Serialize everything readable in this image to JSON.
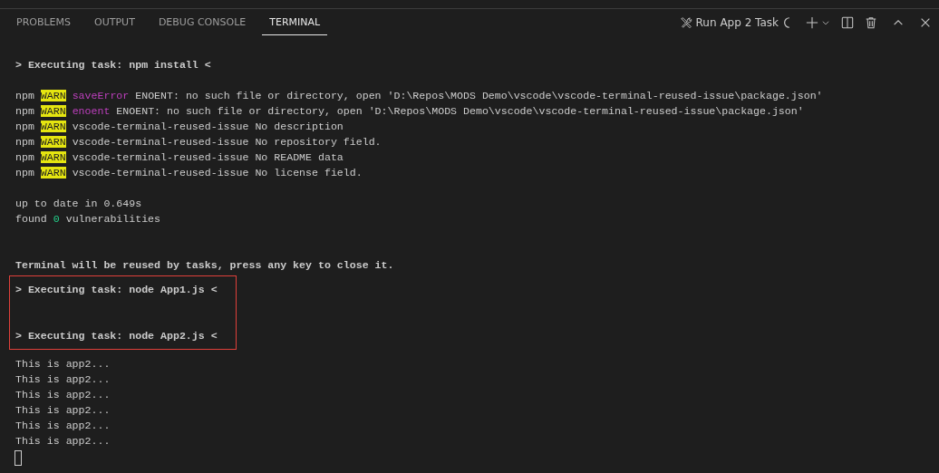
{
  "tabs": [
    {
      "label": "PROBLEMS",
      "selected": false
    },
    {
      "label": "OUTPUT",
      "selected": false
    },
    {
      "label": "DEBUG CONSOLE",
      "selected": false
    },
    {
      "label": "TERMINAL",
      "selected": true
    }
  ],
  "toolbar": {
    "task_label": "Run App 2 Task"
  },
  "terminal": {
    "blocks": [
      {
        "highlighted": false,
        "lines": [
          {
            "kind": "task",
            "segments": [
              {
                "kind": "plain",
                "text": "> Executing task: npm install <"
              }
            ]
          },
          {
            "kind": "blank"
          },
          {
            "kind": "output",
            "segments": [
              {
                "kind": "plain",
                "text": "npm "
              },
              {
                "kind": "warn",
                "text": "WARN"
              },
              {
                "kind": "magenta",
                "text": " saveError"
              },
              {
                "kind": "plain",
                "text": " ENOENT: no such file or directory, open 'D:\\Repos\\MODS Demo\\vscode\\vscode-terminal-reused-issue\\package.json'"
              }
            ]
          },
          {
            "kind": "output",
            "segments": [
              {
                "kind": "plain",
                "text": "npm "
              },
              {
                "kind": "warn",
                "text": "WARN"
              },
              {
                "kind": "magenta",
                "text": " enoent"
              },
              {
                "kind": "plain",
                "text": " ENOENT: no such file or directory, open 'D:\\Repos\\MODS Demo\\vscode\\vscode-terminal-reused-issue\\package.json'"
              }
            ]
          },
          {
            "kind": "output",
            "segments": [
              {
                "kind": "plain",
                "text": "npm "
              },
              {
                "kind": "warn",
                "text": "WARN"
              },
              {
                "kind": "plain",
                "text": " vscode-terminal-reused-issue No description"
              }
            ]
          },
          {
            "kind": "output",
            "segments": [
              {
                "kind": "plain",
                "text": "npm "
              },
              {
                "kind": "warn",
                "text": "WARN"
              },
              {
                "kind": "plain",
                "text": " vscode-terminal-reused-issue No repository field."
              }
            ]
          },
          {
            "kind": "output",
            "segments": [
              {
                "kind": "plain",
                "text": "npm "
              },
              {
                "kind": "warn",
                "text": "WARN"
              },
              {
                "kind": "plain",
                "text": " vscode-terminal-reused-issue No README data"
              }
            ]
          },
          {
            "kind": "output",
            "segments": [
              {
                "kind": "plain",
                "text": "npm "
              },
              {
                "kind": "warn",
                "text": "WARN"
              },
              {
                "kind": "plain",
                "text": " vscode-terminal-reused-issue No license field."
              }
            ]
          },
          {
            "kind": "blank"
          },
          {
            "kind": "output",
            "segments": [
              {
                "kind": "plain",
                "text": "up to date in 0.649s"
              }
            ]
          },
          {
            "kind": "output",
            "segments": [
              {
                "kind": "plain",
                "text": "found "
              },
              {
                "kind": "number",
                "text": "0"
              },
              {
                "kind": "plain",
                "text": " vulnerabilities"
              }
            ]
          },
          {
            "kind": "blank"
          },
          {
            "kind": "blank"
          },
          {
            "kind": "task",
            "segments": [
              {
                "kind": "plain",
                "text": "Terminal will be reused by tasks, press any key to close it."
              }
            ]
          }
        ]
      },
      {
        "highlighted": true,
        "lines": [
          {
            "kind": "task",
            "segments": [
              {
                "kind": "plain",
                "text": "> Executing task: node App1.js <"
              }
            ]
          },
          {
            "kind": "blank"
          },
          {
            "kind": "blank"
          },
          {
            "kind": "task",
            "segments": [
              {
                "kind": "plain",
                "text": "> Executing task: node App2.js <"
              }
            ]
          }
        ]
      },
      {
        "highlighted": false,
        "lines": [
          {
            "kind": "output",
            "segments": [
              {
                "kind": "plain",
                "text": "This is app2..."
              }
            ]
          },
          {
            "kind": "output",
            "segments": [
              {
                "kind": "plain",
                "text": "This is app2..."
              }
            ]
          },
          {
            "kind": "output",
            "segments": [
              {
                "kind": "plain",
                "text": "This is app2..."
              }
            ]
          },
          {
            "kind": "output",
            "segments": [
              {
                "kind": "plain",
                "text": "This is app2..."
              }
            ]
          },
          {
            "kind": "output",
            "segments": [
              {
                "kind": "plain",
                "text": "This is app2..."
              }
            ]
          },
          {
            "kind": "output",
            "segments": [
              {
                "kind": "plain",
                "text": "This is app2..."
              }
            ]
          }
        ]
      }
    ]
  }
}
